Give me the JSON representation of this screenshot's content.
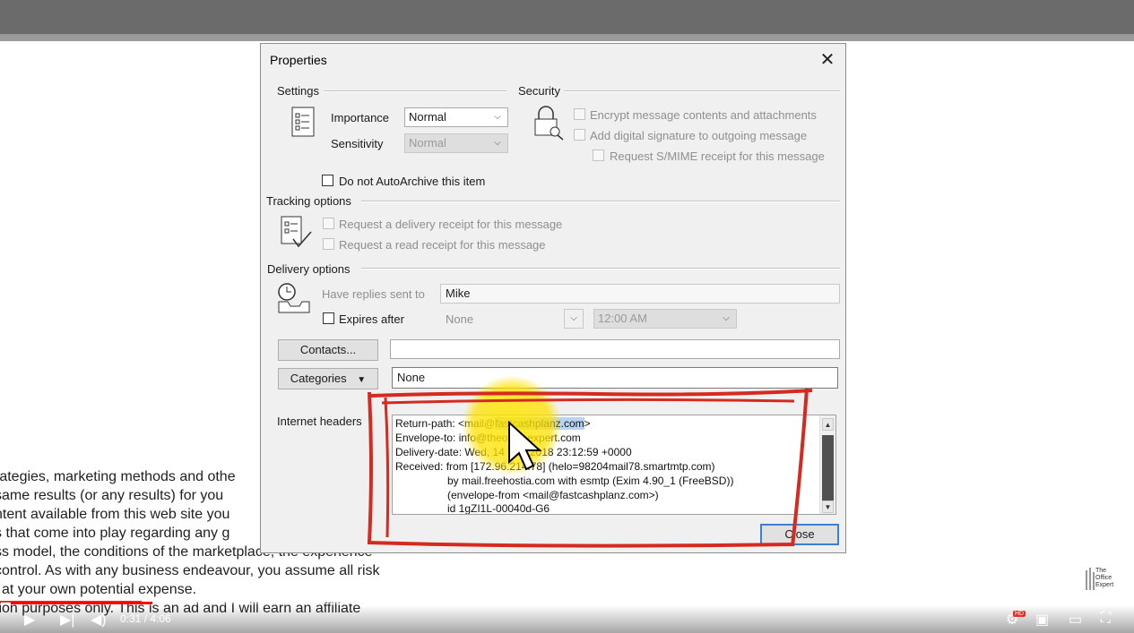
{
  "document": {
    "lines": [
      "rategies, marketing methods and othe",
      "same results (or any results) for you",
      "ntent available from this web site you",
      "s that come into play regarding any g",
      "ss model, the conditions of the marketplace, the experience",
      "control. As with any business endeavour, you assume all risk",
      "l at your own potential expense.",
      "tion purposes only. This is an ad and I will earn an affiliate"
    ]
  },
  "dialog": {
    "title": "Properties",
    "close_glyph": "✕",
    "settings": {
      "label": "Settings",
      "importance_label": "Importance",
      "importance_value": "Normal",
      "sensitivity_label": "Sensitivity",
      "sensitivity_value": "Normal",
      "autoarchive_label": "Do not AutoArchive this item"
    },
    "security": {
      "label": "Security",
      "encrypt_label": "Encrypt message contents and attachments",
      "signature_label": "Add digital signature to outgoing message",
      "smime_label": "Request S/MIME receipt for this message"
    },
    "tracking": {
      "label": "Tracking options",
      "delivery_receipt_label": "Request a delivery receipt for this message",
      "read_receipt_label": "Request a read receipt for this message"
    },
    "delivery": {
      "label": "Delivery options",
      "replies_label": "Have replies sent to",
      "replies_value": "Mike",
      "expires_label": "Expires after",
      "expires_date": "None",
      "expires_time": "12:00 AM"
    },
    "contacts_button": "Contacts...",
    "contacts_value": "",
    "categories_button": "Categories",
    "categories_value": "None",
    "headers": {
      "label": "Internet headers",
      "return_path_prefix": "Return-path: ",
      "return_path_a": "<mail@",
      "return_path_b": "fastcashplanz.com",
      "return_path_c": ">",
      "envelope_to": "Envelope-to: info@theofficeexpert.com",
      "delivery_date": "Delivery-date: Wed, 14 Nov 2018 23:12:59 +0000",
      "received_1": "Received: from [172.96.214.78] (helo=98204mail78.smartmtp.com)",
      "received_2": "by mail.freehostia.com with esmtp (Exim 4.90_1 (FreeBSD))",
      "received_3": "(envelope-from <mail@fastcashplanz.com>)",
      "received_4": "id 1gZI1L-00040d-G6"
    },
    "close_button": "Close"
  },
  "player": {
    "time": "0:31 / 4:06",
    "progress": 0.127,
    "brand": [
      "The",
      "Office",
      "Expert"
    ],
    "hd_badge": "HD"
  }
}
